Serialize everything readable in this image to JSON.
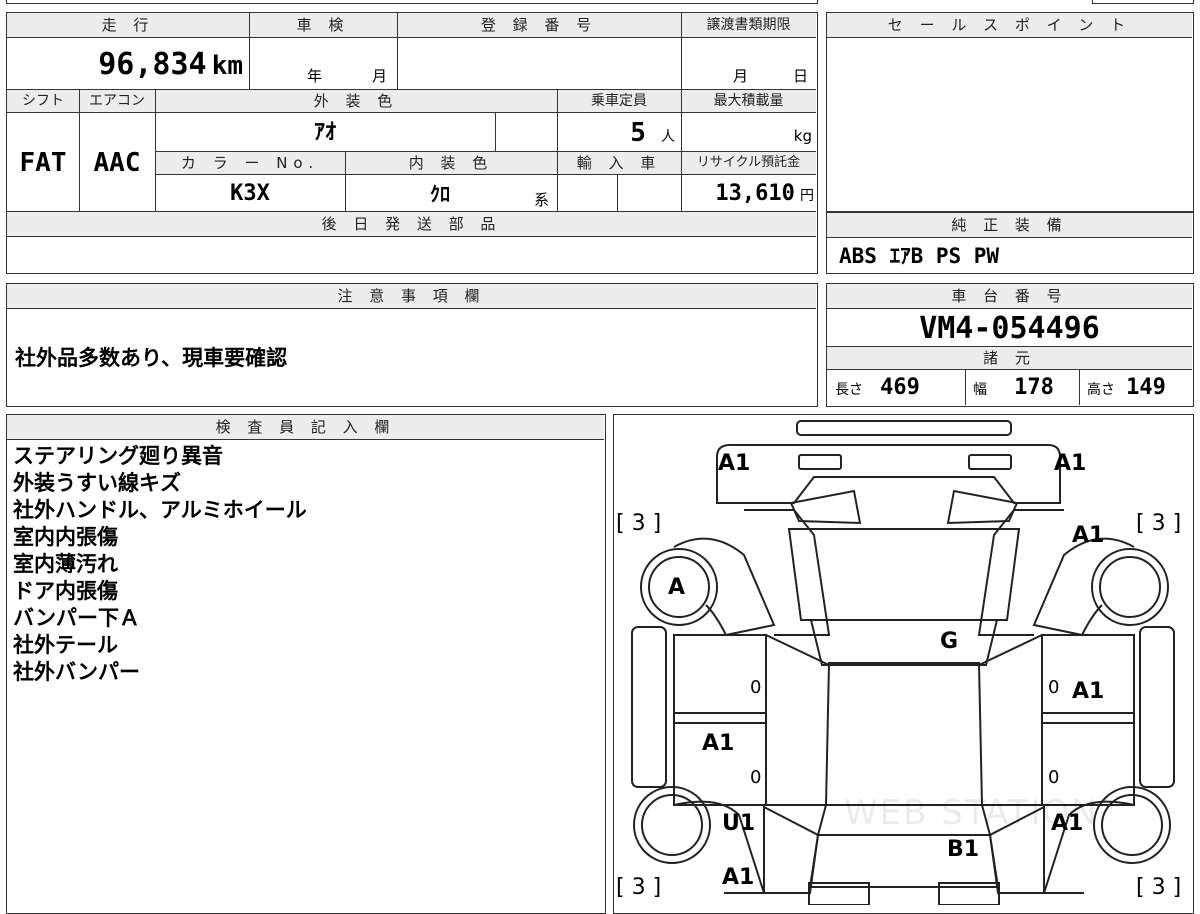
{
  "top_table": {
    "odometer_label": "走 行",
    "inspection_label": "車 検",
    "registration_label": "登 録 番 号",
    "transfer_deadline_label": "譲渡書類期限",
    "odometer_value": "96,834",
    "odometer_unit": "km",
    "year_unit": "年",
    "month_unit": "月",
    "day_unit": "日",
    "shift_label": "シフト",
    "aircon_label": "エアコン",
    "exterior_color_label": "外 装 色",
    "capacity_label": "乗車定員",
    "max_load_label": "最大積載量",
    "shift_value": "FAT",
    "aircon_value": "AAC",
    "exterior_color_value": "ｱｵ",
    "capacity_value": "5",
    "capacity_unit": "人",
    "max_load_unit": "kg",
    "color_no_label": "カ ラ ー No.",
    "interior_color_label": "内 装 色",
    "import_label": "輸 入 車",
    "recycle_label": "リサイクル預託金",
    "color_no_value": "K3X",
    "interior_color_value": "ｸﾛ",
    "interior_color_suffix": "系",
    "recycle_value": "13,610",
    "recycle_unit": "円",
    "later_parts_label": "後 日 発 送 部 品"
  },
  "sale_points": {
    "label": "セ ー ル ス ポ イ ン ト"
  },
  "genuine_equipment": {
    "label": "純 正 装 備",
    "value": "ABS ｴｱB PS PW"
  },
  "notes": {
    "label": "注 意 事 項 欄",
    "value": "社外品多数あり、現車要確認"
  },
  "chassis": {
    "label": "車 台 番 号",
    "value": "VM4-054496"
  },
  "specs": {
    "label": "諸 元",
    "length_label": "長さ",
    "length_value": "469",
    "width_label": "幅",
    "width_value": "178",
    "height_label": "高さ",
    "height_value": "149"
  },
  "inspector": {
    "label": "検 査 員 記 入 欄",
    "lines": [
      "ステアリング廻り異音",
      "外装うすい線キズ",
      "社外ハンドル、アルミホイール",
      "室内内張傷",
      "室内薄汚れ",
      "ドア内張傷",
      "バンパー下Ａ",
      "社外テール",
      "社外バンパー"
    ]
  },
  "car_map": {
    "labels": {
      "front_left": "A1",
      "front_right": "A1",
      "tire_fl": "[ 3 ]",
      "tire_fr": "[ 3 ]",
      "tire_rl": "[ 3 ]",
      "tire_rr": "[ 3 ]",
      "fender_left": "A",
      "fender_right": "A1",
      "hood": "G",
      "door_right_front": "A1",
      "door_left_rear": "A1",
      "rear_fender_left": "U1",
      "rear_fender_right": "A1",
      "trunk": "B1",
      "rear_left": "A1",
      "zero_marks": [
        "0",
        "0",
        "0",
        "0"
      ]
    },
    "watermark": "WEB STATION"
  }
}
